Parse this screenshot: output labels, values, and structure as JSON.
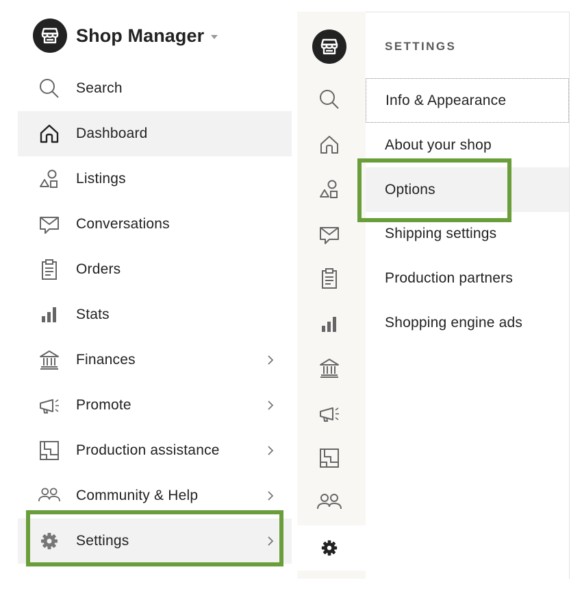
{
  "left_nav": {
    "title": "Shop Manager",
    "items": [
      {
        "label": "Search",
        "icon": "search-icon",
        "has_chevron": false,
        "active": false
      },
      {
        "label": "Dashboard",
        "icon": "home-icon",
        "has_chevron": false,
        "active": true
      },
      {
        "label": "Listings",
        "icon": "shapes-icon",
        "has_chevron": false,
        "active": false
      },
      {
        "label": "Conversations",
        "icon": "message-icon",
        "has_chevron": false,
        "active": false
      },
      {
        "label": "Orders",
        "icon": "clipboard-icon",
        "has_chevron": false,
        "active": false
      },
      {
        "label": "Stats",
        "icon": "bar-chart-icon",
        "has_chevron": false,
        "active": false
      },
      {
        "label": "Finances",
        "icon": "bank-icon",
        "has_chevron": true,
        "active": false
      },
      {
        "label": "Promote",
        "icon": "megaphone-icon",
        "has_chevron": true,
        "active": false
      },
      {
        "label": "Production assistance",
        "icon": "production-icon",
        "has_chevron": true,
        "active": false
      },
      {
        "label": "Community & Help",
        "icon": "people-icon",
        "has_chevron": true,
        "active": false
      },
      {
        "label": "Settings",
        "icon": "gear-icon",
        "has_chevron": true,
        "active": false
      }
    ]
  },
  "settings_panel": {
    "heading": "SETTINGS",
    "items": [
      {
        "label": "Info & Appearance"
      },
      {
        "label": "About your shop"
      },
      {
        "label": "Options"
      },
      {
        "label": "Shipping settings"
      },
      {
        "label": "Production partners"
      },
      {
        "label": "Shopping engine ads"
      }
    ]
  },
  "colors": {
    "highlight": "#6a9e3a",
    "active_bg": "#f2f2f2",
    "rail_bg": "#f8f7f4",
    "icon": "#666666",
    "text": "#222222"
  }
}
